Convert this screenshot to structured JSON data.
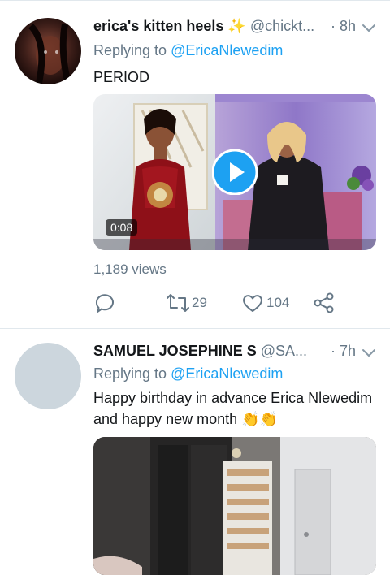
{
  "tweets": [
    {
      "name": "erica's kitten heels",
      "name_emoji": "✨",
      "handle": "@chickt...",
      "time": "· 8h",
      "replying_label": "Replying to",
      "replying_to": "@EricaNlewedim",
      "text": "PERIOD",
      "video_duration": "0:08",
      "views": "1,189 views",
      "retweets": "29",
      "likes": "104"
    },
    {
      "name": "SAMUEL JOSEPHINE S",
      "handle": "@SA...",
      "time": "· 7h",
      "replying_label": "Replying to",
      "replying_to": "@EricaNlewedim",
      "text": "Happy birthday in advance Erica Nlewedim and happy new month",
      "text_emoji": "👏👏"
    }
  ],
  "colors": {
    "accent": "#1da1f2",
    "secondary_text": "#657786",
    "divider": "#e1e8ed"
  },
  "icons": {
    "video_play": "play-icon",
    "reply": "comment-icon",
    "retweet": "retweet-icon",
    "like": "heart-icon",
    "share": "share-icon",
    "more": "chevron-down-icon"
  }
}
